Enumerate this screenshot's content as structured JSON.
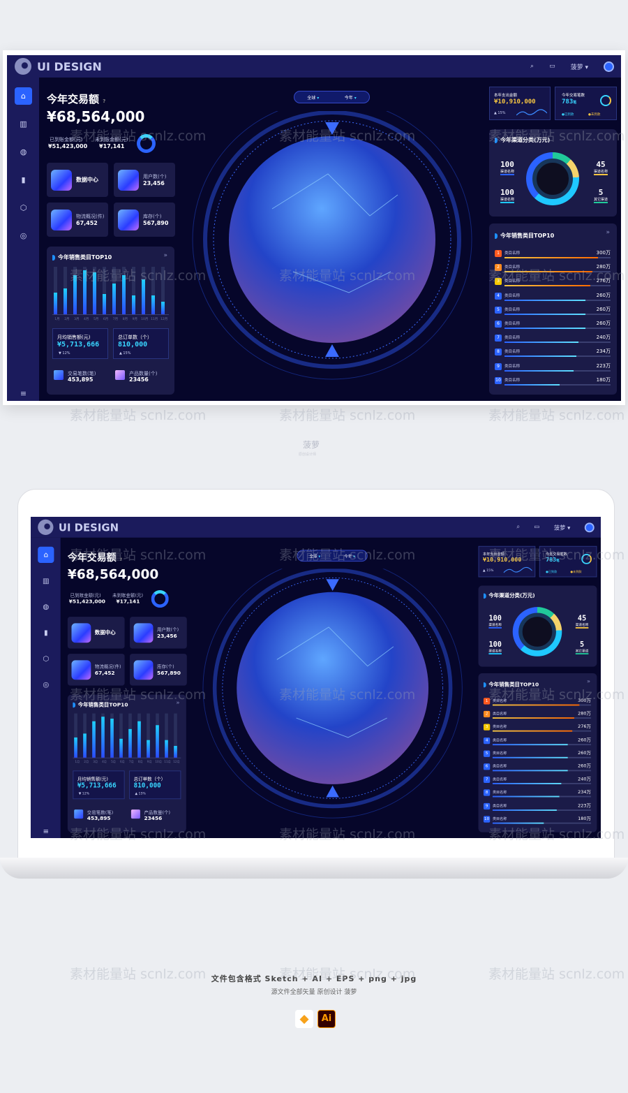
{
  "header": {
    "brand": "UI DESIGN",
    "user": "菠萝 ▾"
  },
  "sidebar": {
    "icons": [
      "home-icon",
      "map-icon",
      "globe-icon",
      "bar-chart-icon",
      "cube-icon",
      "target-icon"
    ],
    "menu": "≡"
  },
  "summary": {
    "title": "今年交易额",
    "help": "?",
    "amount": "¥68,564,000",
    "received_label": "已到账金额(元)",
    "received": "¥51,423,000",
    "pending_label": "未到账金额(元)",
    "pending": "¥17,141"
  },
  "tiles": [
    {
      "label": "数据中心",
      "value": ""
    },
    {
      "label": "用户数(个)",
      "value": "23,456"
    },
    {
      "label": "物流概况(件)",
      "value": "67,452"
    },
    {
      "label": "库存(个)",
      "value": "567,890"
    }
  ],
  "sales_chart": {
    "title": "今年销售类目TOP10",
    "more": "»",
    "months": [
      "1月",
      "2月",
      "3月",
      "4月",
      "5月",
      "6月",
      "7月",
      "8月",
      "9月",
      "10月",
      "11月",
      "12月"
    ],
    "values": [
      0.45,
      0.55,
      0.83,
      0.92,
      0.88,
      0.43,
      0.64,
      0.83,
      0.4,
      0.73,
      0.39,
      0.27
    ]
  },
  "stats": {
    "avg_label": "月均销售额(元)",
    "avg": "¥5,713,666",
    "avg_change": "▼ 12%",
    "orders_label": "总订单数（个）",
    "orders": "810,000",
    "orders_change": "▲ 15%",
    "trades_label": "交易笔数(笔)",
    "trades": "453,895",
    "products_label": "产品数量(个)",
    "products": "23456"
  },
  "filters": {
    "region": "全球",
    "period": "今年"
  },
  "cards": {
    "expense_label": "本年支出金额",
    "expense": "¥10,910,000",
    "expense_change": "▲ 15%",
    "trade_label": "今年交易笔数",
    "trade": "783",
    "trade_unit": "笔",
    "legend_paid": "●已到款",
    "legend_unpaid": "●未到款"
  },
  "channels": {
    "title": "今年渠道分类(万元)",
    "items": [
      {
        "value": "100",
        "label": "渠道名称"
      },
      {
        "value": "45",
        "label": "渠道名称"
      },
      {
        "value": "100",
        "label": "渠道名称"
      },
      {
        "value": "5",
        "label": "其它渠道"
      }
    ]
  },
  "ranking": {
    "title": "今年销售类目TOP10",
    "more": "»",
    "rows": [
      {
        "rank": "1",
        "name": "类目名称",
        "value": "300万",
        "pct": 0.88
      },
      {
        "rank": "2",
        "name": "类目名称",
        "value": "280万",
        "pct": 0.83
      },
      {
        "rank": "3",
        "name": "类目名称",
        "value": "276万",
        "pct": 0.81
      },
      {
        "rank": "4",
        "name": "类目名称",
        "value": "260万",
        "pct": 0.76
      },
      {
        "rank": "5",
        "name": "类目名称",
        "value": "260万",
        "pct": 0.76
      },
      {
        "rank": "6",
        "name": "类目名称",
        "value": "260万",
        "pct": 0.76
      },
      {
        "rank": "7",
        "name": "类目名称",
        "value": "240万",
        "pct": 0.7
      },
      {
        "rank": "8",
        "name": "类目名称",
        "value": "234万",
        "pct": 0.68
      },
      {
        "rank": "9",
        "name": "类目名称",
        "value": "223万",
        "pct": 0.65
      },
      {
        "rank": "10",
        "name": "类目名称",
        "value": "180万",
        "pct": 0.52
      }
    ]
  },
  "colors": {
    "accent": "#2b63ff",
    "gold": "#f5c542",
    "cyan": "#39d5ff",
    "orange": "#ff6a00"
  },
  "footer": {
    "author": "菠萝",
    "author_sub": "原创设计师",
    "formats": "文件包含格式 Sketch + AI + EPS + png + jpg",
    "note": "源文件全部矢量 原创设计 菠萝",
    "ai": "Ai"
  },
  "watermark": "素材能量站 scnlz.com"
}
